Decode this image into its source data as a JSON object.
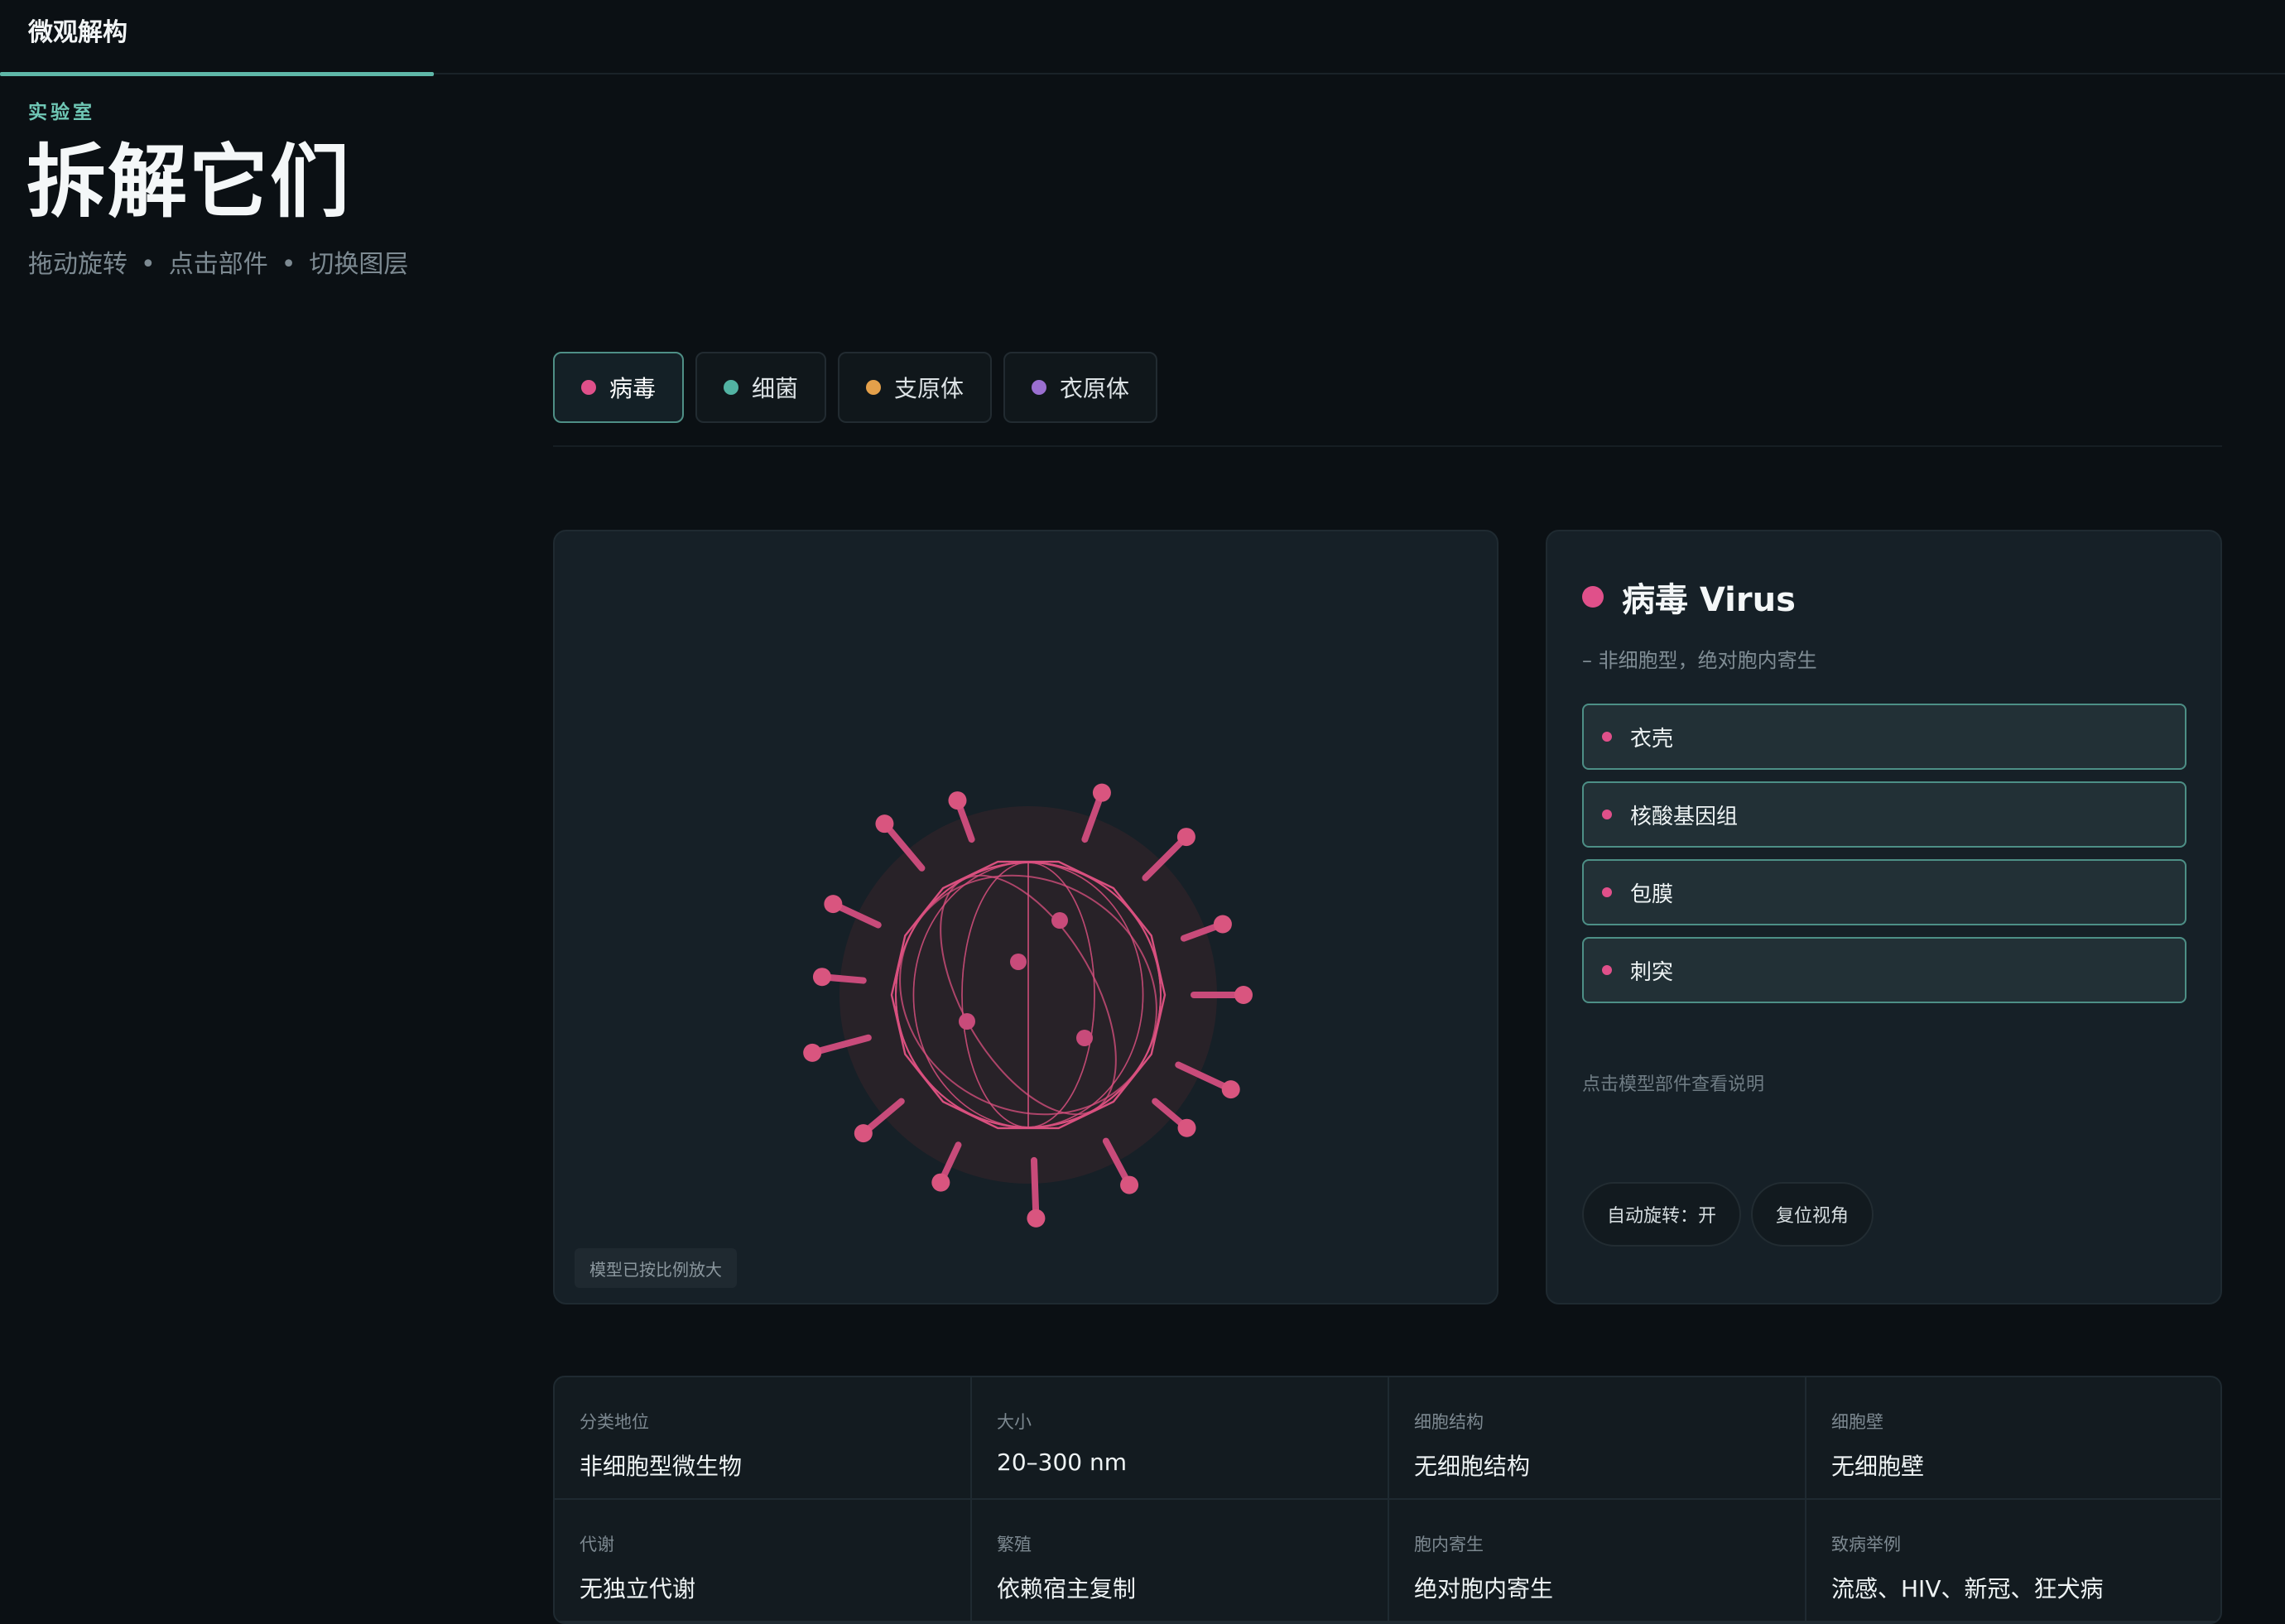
{
  "app": {
    "brand": "微观解构"
  },
  "progress": {
    "fraction": 0.19
  },
  "hero": {
    "eyebrow": "实验室",
    "title": "拆解它们",
    "hints": [
      "拖动旋转",
      "点击部件",
      "切换图层"
    ]
  },
  "tabs": [
    {
      "label": "病毒",
      "color": "#e0508a",
      "active": true
    },
    {
      "label": "细菌",
      "color": "#52b3a3",
      "active": false
    },
    {
      "label": "支原体",
      "color": "#e4a04a",
      "active": false
    },
    {
      "label": "衣原体",
      "color": "#9a6fd0",
      "active": false
    }
  ],
  "stage": {
    "caption": "模型已按比例放大",
    "accent": "#d9507f"
  },
  "panel": {
    "title": "病毒 Virus",
    "color": "#e0508a",
    "desc": "– 非细胞型，绝对胞内寄生",
    "parts": [
      "衣壳",
      "核酸基因组",
      "包膜",
      "刺突"
    ],
    "hint": "点击模型部件查看说明",
    "auto_rotate": "自动旋转：开",
    "reset_view": "复位视角"
  },
  "facts": [
    {
      "k": "分类地位",
      "v": "非细胞型微生物"
    },
    {
      "k": "大小",
      "v": "20–300 nm"
    },
    {
      "k": "细胞结构",
      "v": "无细胞结构"
    },
    {
      "k": "细胞壁",
      "v": "无细胞壁"
    },
    {
      "k": "代谢",
      "v": "无独立代谢"
    },
    {
      "k": "繁殖",
      "v": "依赖宿主复制"
    },
    {
      "k": "胞内寄生",
      "v": "绝对胞内寄生"
    },
    {
      "k": "致病举例",
      "v": "流感、HIV、新冠、狂犬病"
    }
  ]
}
